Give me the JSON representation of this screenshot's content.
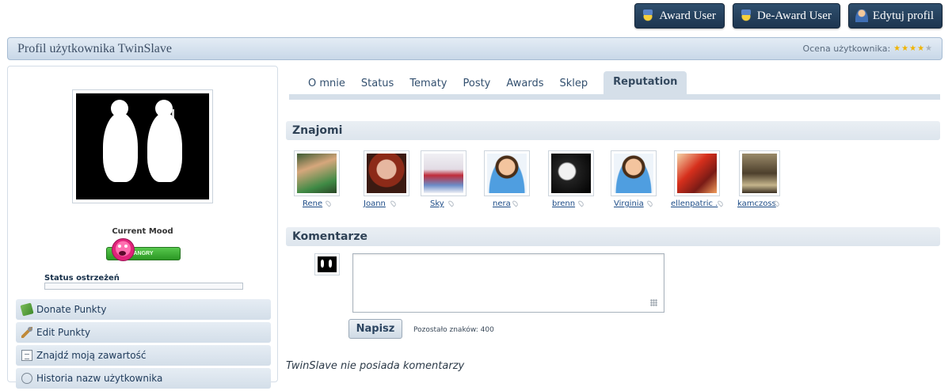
{
  "top_actions": [
    {
      "label": "Award User",
      "icon": "award-icon"
    },
    {
      "label": "De-Award User",
      "icon": "award-icon"
    },
    {
      "label": "Edytuj profil",
      "icon": "user-edit-icon"
    }
  ],
  "profile": {
    "title": "Profil użytkownika TwinSlave",
    "rating_label": "Ocena użytkownika:",
    "rating_stars": 4,
    "rating_max": 5
  },
  "sidebar": {
    "mood_label": "Current Mood",
    "mood_value": "ANGRY",
    "warning_label": "Status ostrzeżeń",
    "menu": [
      {
        "label": "Donate Punkty",
        "icon": "money-icon"
      },
      {
        "label": "Edit Punkty",
        "icon": "wrench-icon"
      },
      {
        "label": "Znajdź moją zawartość",
        "icon": "document-search-icon"
      },
      {
        "label": "Historia nazw użytkownika",
        "icon": "history-icon"
      }
    ]
  },
  "tabs": [
    {
      "label": "O mnie",
      "active": false
    },
    {
      "label": "Status",
      "active": false
    },
    {
      "label": "Tematy",
      "active": false
    },
    {
      "label": "Posty",
      "active": false
    },
    {
      "label": "Awards",
      "active": false
    },
    {
      "label": "Sklep",
      "active": false
    },
    {
      "label": "Reputation",
      "active": true
    }
  ],
  "friends": {
    "heading": "Znajomi",
    "items": [
      {
        "name": "Rene"
      },
      {
        "name": "Joann"
      },
      {
        "name": "Sky"
      },
      {
        "name": "nera"
      },
      {
        "name": "brenn"
      },
      {
        "name": "Virginia"
      },
      {
        "name": "ellenpatric ."
      },
      {
        "name": "kamczoss"
      }
    ]
  },
  "comments": {
    "heading": "Komentarze",
    "input_value": "",
    "submit_label": "Napisz",
    "remaining_label": "Pozostało znaków:",
    "remaining_count": "400",
    "empty_text": "TwinSlave nie posiada komentarzy"
  }
}
